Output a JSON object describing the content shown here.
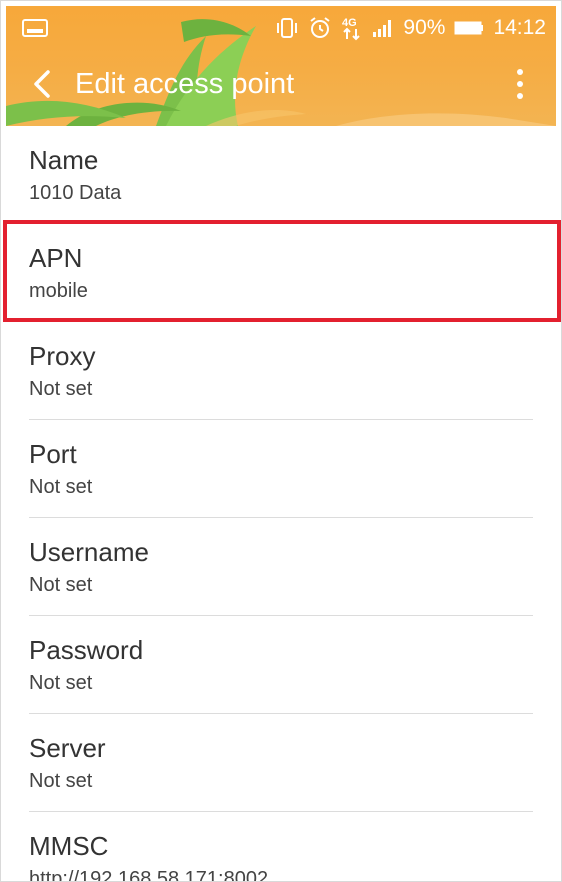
{
  "status_bar": {
    "battery_percent": "90%",
    "time": "14:12",
    "network": "4G",
    "icons": [
      "screenshot-icon",
      "vibrate-icon",
      "alarm-icon",
      "4g-data-icon",
      "signal-icon",
      "battery-icon"
    ]
  },
  "toolbar": {
    "title": "Edit access point",
    "back_icon": "chevron-left-icon",
    "menu_icon": "more-vert-icon"
  },
  "settings": [
    {
      "label": "Name",
      "value": "1010 Data"
    },
    {
      "label": "APN",
      "value": "mobile"
    },
    {
      "label": "Proxy",
      "value": "Not set"
    },
    {
      "label": "Port",
      "value": "Not set"
    },
    {
      "label": "Username",
      "value": "Not set"
    },
    {
      "label": "Password",
      "value": "Not set"
    },
    {
      "label": "Server",
      "value": "Not set"
    },
    {
      "label": "MMSC",
      "value": "http://192.168.58.171:8002"
    }
  ],
  "highlighted_item": "APN",
  "colors": {
    "header": "#f5ad45",
    "highlight_border": "#e3202f",
    "leaf_green": "#7cc04a",
    "text_primary": "#333333"
  }
}
